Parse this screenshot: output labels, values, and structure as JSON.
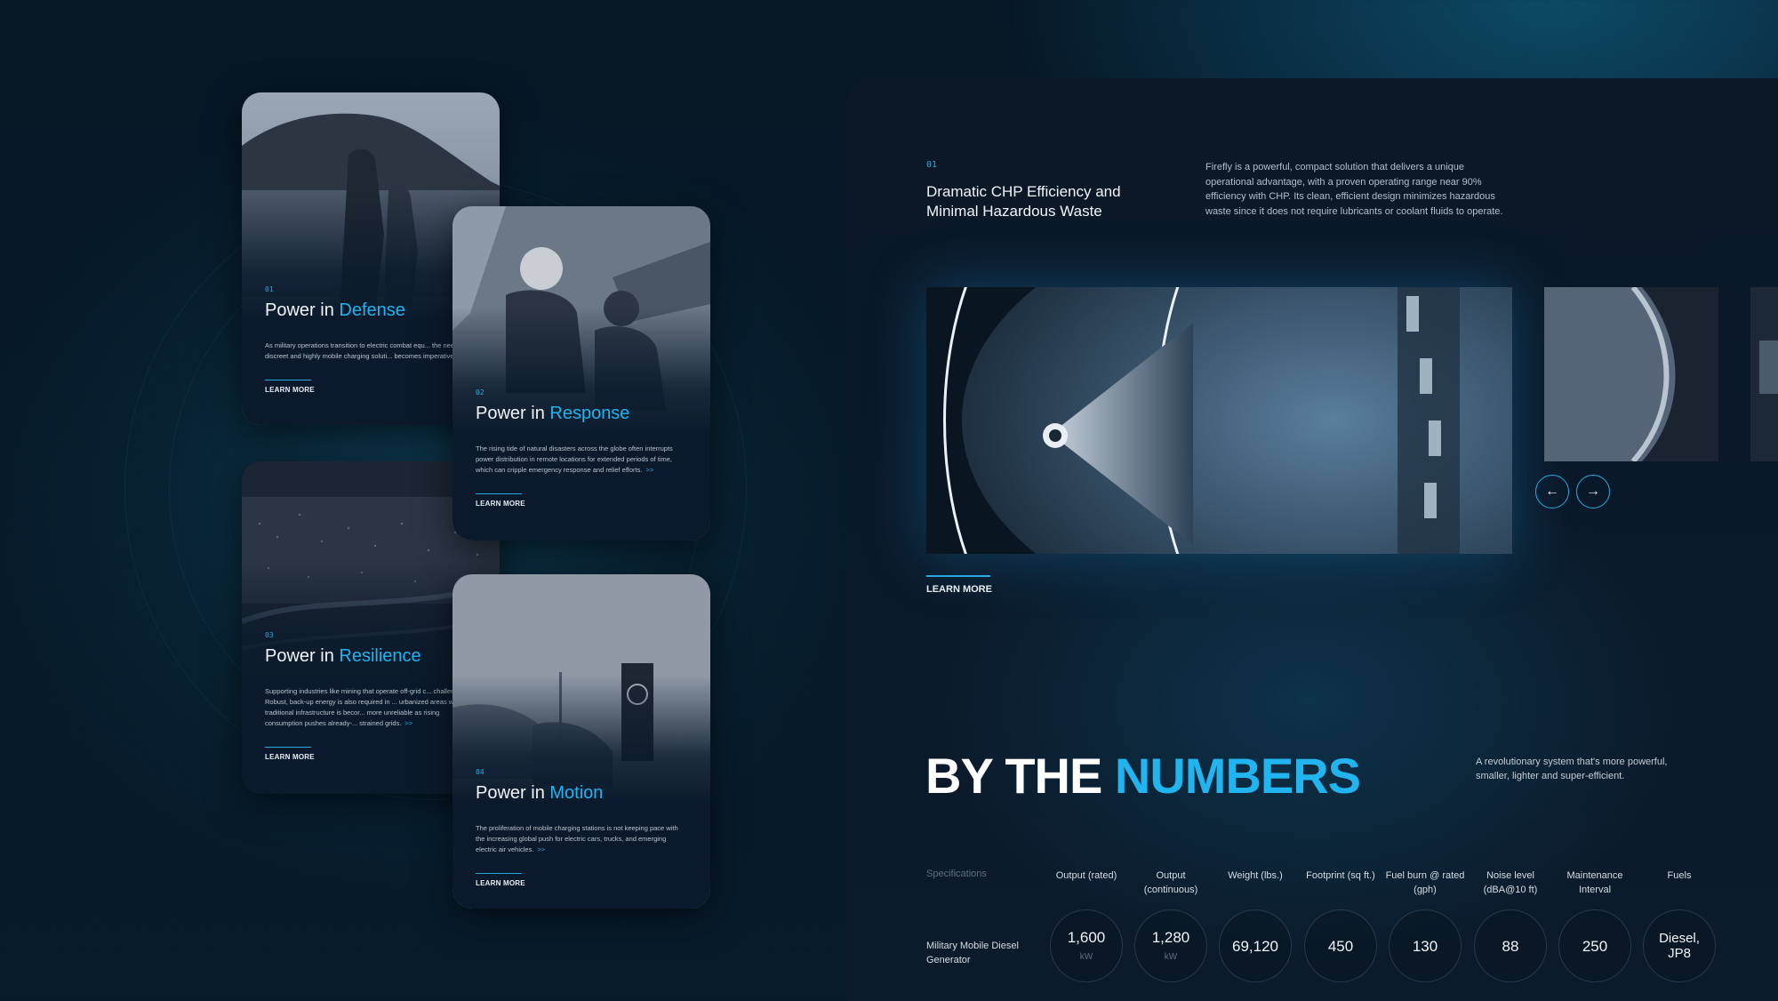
{
  "cards": [
    {
      "num": "01",
      "title_pre": "Power in ",
      "title_hl": "Defense",
      "desc": "As military operations transition to electric combat equ... the need for a discreet and highly mobile charging soluti... becomes imperative.",
      "more": ">>",
      "learn": "LEARN MORE"
    },
    {
      "num": "02",
      "title_pre": "Power in ",
      "title_hl": "Response",
      "desc": "The rising tide of natural disasters across the globe often interrupts power distribution in remote locations for extended periods of time, which can cripple emergency response and relief efforts.",
      "more": ">>",
      "learn": "LEARN MORE"
    },
    {
      "num": "03",
      "title_pre": "Power in ",
      "title_hl": "Resilience",
      "desc": "Supporting industries like mining that operate off-grid c... challenging. Robust, back-up energy is also required in ... urbanized areas where traditional infrastructure is becor... more unreliable as rising consumption pushes already-... strained grids.",
      "more": ">>",
      "learn": "LEARN MORE"
    },
    {
      "num": "04",
      "title_pre": "Power in ",
      "title_hl": "Motion",
      "desc": "The proliferation of mobile charging stations is not keeping pace with the increasing global push for electric cars, trucks, and emerging electric air vehicles.",
      "more": ">>",
      "learn": "LEARN MORE"
    }
  ],
  "feature": {
    "num": "01",
    "title": "Dramatic CHP Efficiency and Minimal Hazardous Waste",
    "desc": "Firefly is a powerful, compact solution that delivers a unique operational advantage, with a proven operating range near 90% efficiency with CHP. Its clean, efficient design minimizes hazardous waste since it does not require lubricants or coolant fluids to operate.",
    "learn": "LEARN MORE",
    "prev": "←",
    "next": "→"
  },
  "numbers": {
    "head_pre": "BY THE ",
    "head_hl": "NUMBERS",
    "sub": "A revolutionary system that's more powerful, smaller, lighter and super-efficient.",
    "spec_label": "Specifications",
    "row_label": "Military Mobile Diesel Generator",
    "columns": [
      {
        "head": "Output (rated)",
        "value": "1,600",
        "unit": "kW"
      },
      {
        "head": "Output (continuous)",
        "value": "1,280",
        "unit": "kW"
      },
      {
        "head": "Weight (lbs.)",
        "value": "69,120",
        "unit": ""
      },
      {
        "head": "Footprint (sq ft.)",
        "value": "450",
        "unit": ""
      },
      {
        "head": "Fuel burn @ rated (gph)",
        "value": "130",
        "unit": ""
      },
      {
        "head": "Noise level (dBA@10 ft)",
        "value": "88",
        "unit": ""
      },
      {
        "head": "Maintenance Interval",
        "value": "250",
        "unit": ""
      },
      {
        "head": "Fuels",
        "value": "Diesel, JP8",
        "unit": ""
      }
    ]
  },
  "colors": {
    "accent": "#21b4ee",
    "background": "#061726",
    "card": "#0a1a2c"
  }
}
